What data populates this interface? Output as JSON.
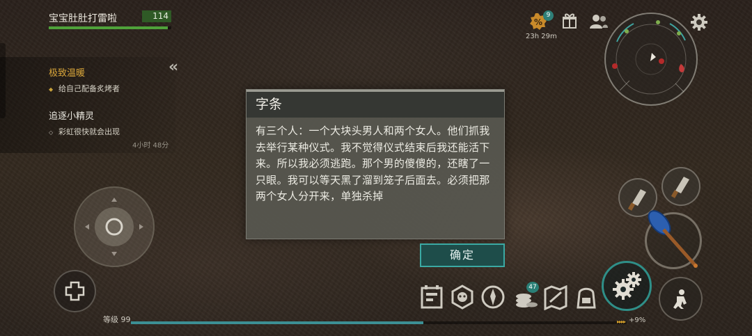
{
  "player": {
    "name": "宝宝肚肚打雷啦",
    "health": "114",
    "health_fraction": 0.97
  },
  "quests": [
    {
      "title": "极致温暖",
      "title_color": "#d9a63a",
      "task": "给自己配备炙烤者"
    },
    {
      "title": "追逐小精灵",
      "title_color": "#e8e6de",
      "task": "彩虹很快就会出现",
      "timer": "4小时 48分"
    }
  ],
  "top_bar": {
    "promo_badge": "9",
    "promo_timer": "23h 29m"
  },
  "dialog": {
    "title": "字条",
    "body": "有三个人：一个大块头男人和两个女人。他们抓我去举行某种仪式。我不觉得仪式结束后我还能活下来。所以我必须逃跑。那个男的傻傻的，还瞎了一只眼。我可以等天黑了溜到笼子后面去。必须把那两个女人分开来，单独杀掉",
    "confirm_label": "确定"
  },
  "inventory_bar": {
    "coins_badge": "47"
  },
  "xp": {
    "level_label": "等级 99",
    "progress_fraction": 0.59,
    "bonus": "+9%"
  },
  "colors": {
    "accent_teal": "#3ba9a3",
    "health_green": "#4fa23a",
    "quest_gold": "#d9a63a"
  },
  "icons": [
    "promo-percent-icon",
    "gift-icon",
    "friends-icon",
    "settings-icon",
    "minimap",
    "joystick",
    "medkit-plus-icon",
    "cleaver-icon",
    "paddle-weapon-icon",
    "craft-gears-icon",
    "sneak-icon",
    "backpack-icon",
    "map-icon",
    "coins-icon",
    "clan-icon",
    "achievements-icon",
    "journal-icon"
  ]
}
